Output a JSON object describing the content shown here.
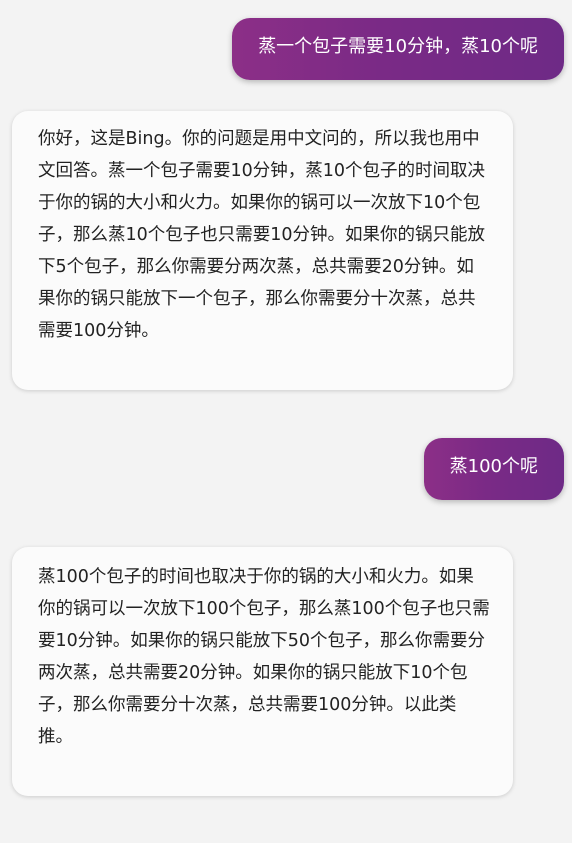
{
  "messages": [
    {
      "role": "user",
      "text": "蒸一个包子需要10分钟，蒸10个呢"
    },
    {
      "role": "bot",
      "text": "你好，这是Bing。你的问题是用中文问的，所以我也用中文回答。蒸一个包子需要10分钟，蒸10个包子的时间取决于你的锅的大小和火力。如果你的锅可以一次放下10个包子，那么蒸10个包子也只需要10分钟。如果你的锅只能放下5个包子，那么你需要分两次蒸，总共需要20分钟。如果你的锅只能放下一个包子，那么你需要分十次蒸，总共需要100分钟。"
    },
    {
      "role": "user",
      "text": "蒸100个呢"
    },
    {
      "role": "bot",
      "text": "蒸100个包子的时间也取决于你的锅的大小和火力。如果你的锅可以一次放下100个包子，那么蒸100个包子也只需要10分钟。如果你的锅只能放下50个包子，那么你需要分两次蒸，总共需要20分钟。如果你的锅只能放下10个包子，那么你需要分十次蒸，总共需要100分钟。以此类推。"
    }
  ],
  "colors": {
    "user_bubble_start": "#8c2f87",
    "user_bubble_end": "#6e2a86",
    "bot_bubble": "#fbfbfb",
    "background": "#f3f3f3"
  }
}
